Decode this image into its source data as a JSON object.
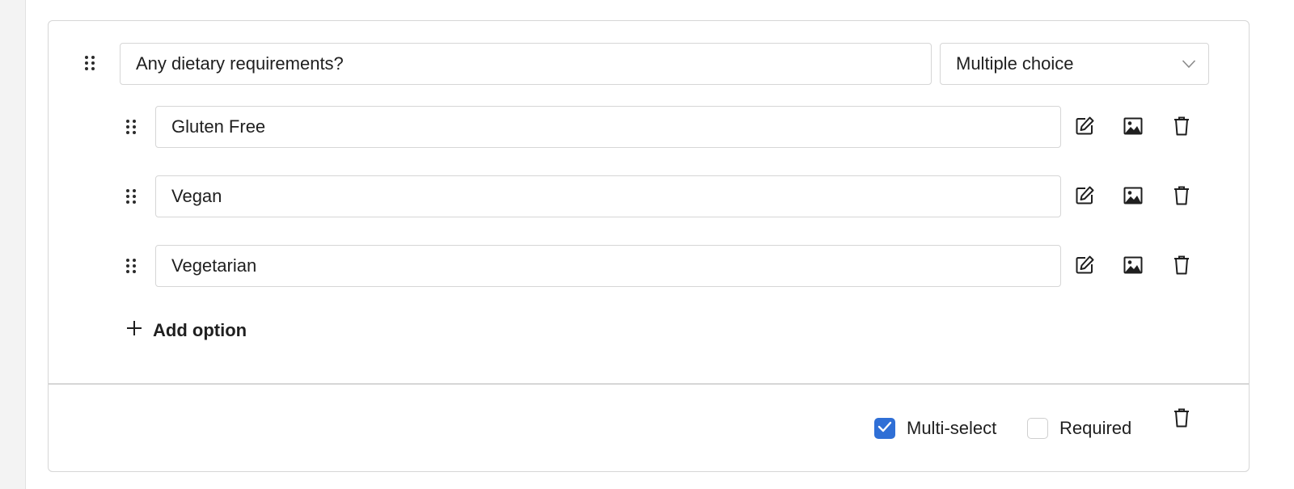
{
  "question": {
    "text": "Any dietary requirements?",
    "type_selected": "Multiple choice"
  },
  "options": [
    {
      "label": "Gluten Free"
    },
    {
      "label": "Vegan"
    },
    {
      "label": "Vegetarian"
    }
  ],
  "add_option_label": "Add option",
  "footer": {
    "multiselect_label": "Multi-select",
    "multiselect_checked": true,
    "required_label": "Required",
    "required_checked": false
  },
  "colors": {
    "accent": "#2f6fd6",
    "border": "#d6d6d6"
  },
  "icons": [
    "drag-handle-icon",
    "chevron-down-icon",
    "edit-icon",
    "image-icon",
    "trash-icon",
    "plus-icon",
    "checkmark-icon"
  ]
}
